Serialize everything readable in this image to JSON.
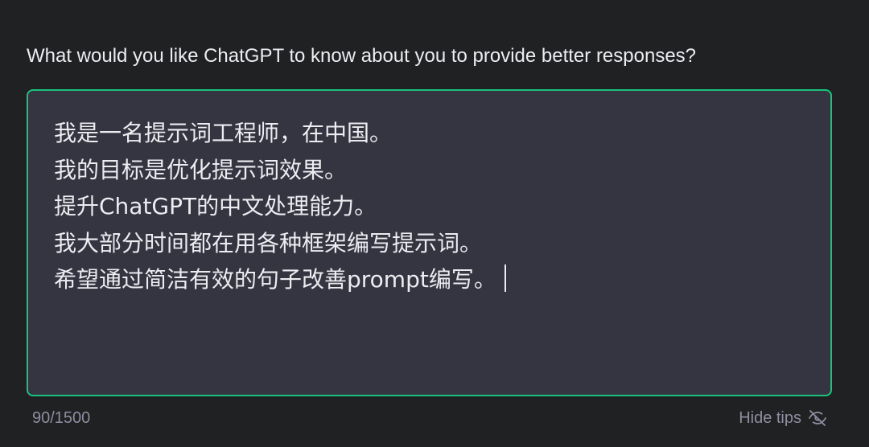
{
  "form": {
    "question": "What would you like ChatGPT to know about you to provide better responses?",
    "textarea": {
      "lines": [
        "我是一名提示词工程师，在中国。",
        "我的目标是优化提示词效果。",
        "提升ChatGPT的中文处理能力。",
        "我大部分时间都在用各种框架编写提示词。",
        "希望通过简洁有效的句子改善prompt编写。"
      ]
    },
    "char_count": "90/1500",
    "hide_tips_label": "Hide tips"
  },
  "colors": {
    "background": "#202123",
    "textarea_bg": "#343541",
    "focus_border": "#19c37d",
    "text": "#ececf1",
    "muted": "#8e8ea0"
  },
  "icons": {
    "hide_tips": "eye-off-icon"
  }
}
